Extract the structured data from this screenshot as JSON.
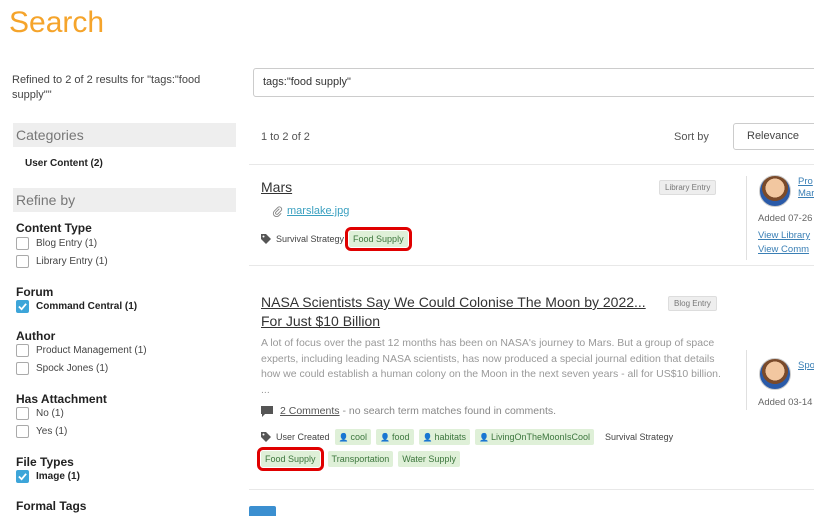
{
  "page": {
    "title": "Search"
  },
  "refined": {
    "text": "Refined to 2 of 2 results for \"tags:\"food supply\"\""
  },
  "search": {
    "value": "tags:\"food supply\""
  },
  "sidebar": {
    "categories_heading": "Categories",
    "category_item": "User Content (2)",
    "refine_heading": "Refine by",
    "facets": {
      "content_type": {
        "label": "Content Type",
        "options": [
          {
            "label": "Blog Entry (1)",
            "checked": false
          },
          {
            "label": "Library Entry (1)",
            "checked": false
          }
        ]
      },
      "forum": {
        "label": "Forum",
        "options": [
          {
            "label": "Command Central (1)",
            "checked": true
          }
        ]
      },
      "author": {
        "label": "Author",
        "options": [
          {
            "label": "Product Management (1)",
            "checked": false
          },
          {
            "label": "Spock Jones (1)",
            "checked": false
          }
        ]
      },
      "has_attachment": {
        "label": "Has Attachment",
        "options": [
          {
            "label": "No (1)",
            "checked": false
          },
          {
            "label": "Yes (1)",
            "checked": false
          }
        ]
      },
      "file_types": {
        "label": "File Types",
        "options": [
          {
            "label": "Image (1)",
            "checked": true
          }
        ]
      },
      "formal_tags": {
        "label": "Formal Tags"
      }
    }
  },
  "results_header": {
    "count": "1 to 2 of 2",
    "sort_label": "Sort by",
    "sort_value": "Relevance"
  },
  "results": [
    {
      "title": "Mars",
      "type": "Library Entry",
      "attachment": "marslake.jpg",
      "tags_plain": "Survival Strategy",
      "tags_highlight": "Food Supply",
      "meta": {
        "author_line1": "Pro",
        "author_line2": "Mar",
        "added": "Added 07-26",
        "link1": "View Library",
        "link2": "View Comm"
      }
    },
    {
      "title_line1": "NASA Scientists Say We Could Colonise The Moon by 2022...",
      "title_line2": "For Just $10 Billion",
      "type": "Blog Entry",
      "snippet": "A lot of focus over the past 12 months has been on NASA's journey to Mars. But a group of space experts, including leading NASA scientists, has now produced a special journal edition that details how we could establish a human colony on the Moon in the next seven years - all for US$10 billion. ...",
      "comments_link": "2 Comments",
      "comments_text": " - no search term matches found in comments.",
      "tags_prefix": "User Created",
      "user_tags": [
        "cool",
        "food",
        "habitats",
        "LivingOnTheMoonIsCool"
      ],
      "tags_plain": "Survival Strategy",
      "tags_highlight": "Food Supply",
      "tags_more": [
        "Transportation",
        "Water Supply"
      ],
      "meta": {
        "author": "Spo",
        "added": "Added 03-14"
      }
    }
  ],
  "colors": {
    "title": "#f5a42b",
    "tag_bg": "#dff0d8",
    "tag_text": "#3c763d",
    "highlight": "#e00000",
    "check": "#3da5d9"
  },
  "icons": [
    "paperclip-icon",
    "tag-icon",
    "comment-icon",
    "user-icon",
    "check-icon"
  ]
}
